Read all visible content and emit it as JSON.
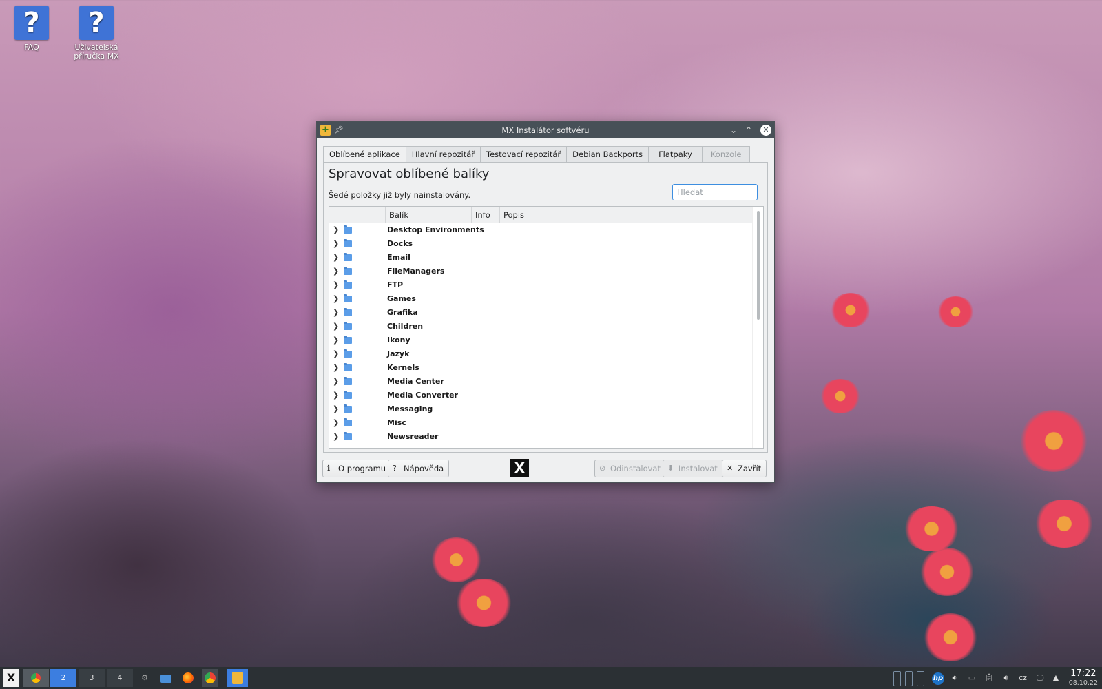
{
  "desktop": {
    "icons": [
      {
        "label": "FAQ",
        "glyph": "?"
      },
      {
        "label": "Uživatelská příručka MX",
        "glyph": "?"
      }
    ]
  },
  "window": {
    "title": "MX Instalátor softvéru",
    "tabs": [
      {
        "label": "Oblíbené aplikace",
        "state": "active"
      },
      {
        "label": "Hlavní repozitář",
        "state": "normal"
      },
      {
        "label": "Testovací repozitář",
        "state": "normal"
      },
      {
        "label": "Debian Backports",
        "state": "normal"
      },
      {
        "label": "Flatpaky",
        "state": "normal"
      },
      {
        "label": "Konzole",
        "state": "disabled"
      }
    ],
    "heading": "Spravovat oblíbené balíky",
    "subtext": "Šedé položky již byly nainstalovány.",
    "search": {
      "placeholder": "Hledat",
      "value": ""
    },
    "columns": [
      "",
      "",
      "Balík",
      "Info",
      "Popis"
    ],
    "rows": [
      "Desktop Environments",
      "Docks",
      "Email",
      "FileManagers",
      "FTP",
      "Games",
      "Grafika",
      "Children",
      "Ikony",
      "Jazyk",
      "Kernels",
      "Media Center",
      "Media Converter",
      "Messaging",
      "Misc",
      "Newsreader"
    ],
    "buttons": {
      "about": "O programu",
      "help": "Nápověda",
      "uninstall": "Odinstalovat",
      "install": "Instalovat",
      "close": "Zavřít"
    },
    "logo": "X"
  },
  "taskbar": {
    "workspaces": [
      "2",
      "3",
      "4"
    ],
    "keyboard_layout": "cz",
    "time": "17:22",
    "date": "08.10.22"
  },
  "colors": {
    "titlebar": "#475057",
    "accent": "#3c7ee0",
    "taskbar": "#2b3034"
  }
}
